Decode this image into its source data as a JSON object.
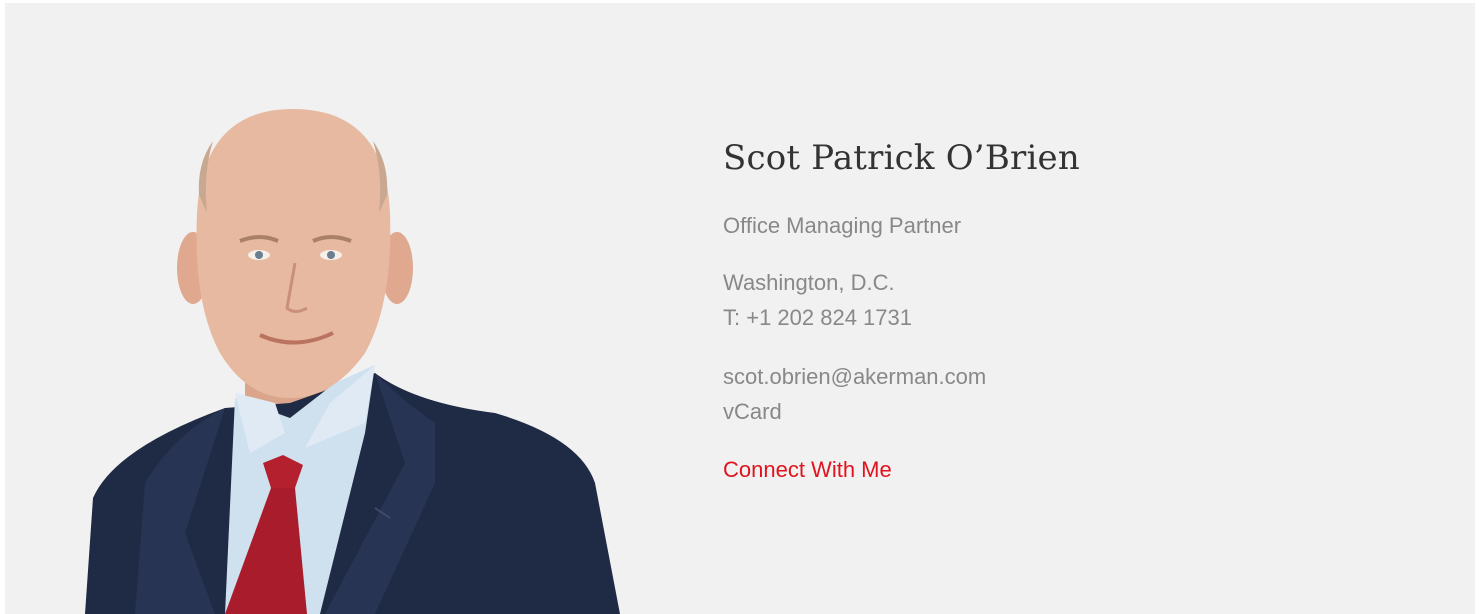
{
  "profile": {
    "name": "Scot Patrick O’Brien",
    "title": "Office Managing Partner",
    "location": "Washington, D.C.",
    "phone": "T: +1 202 824 1731",
    "email": "scot.obrien@akerman.com",
    "vcard": "vCard",
    "connect": "Connect With Me"
  },
  "colors": {
    "panel_bg": "#f1f1f1",
    "name_text": "#333333",
    "body_text": "#888888",
    "accent_red": "#e0141e",
    "suit_navy": "#1f2a44",
    "shirt_blue": "#cfe0ef",
    "tie_red": "#b5202f",
    "skin": "#e7b9a0"
  }
}
